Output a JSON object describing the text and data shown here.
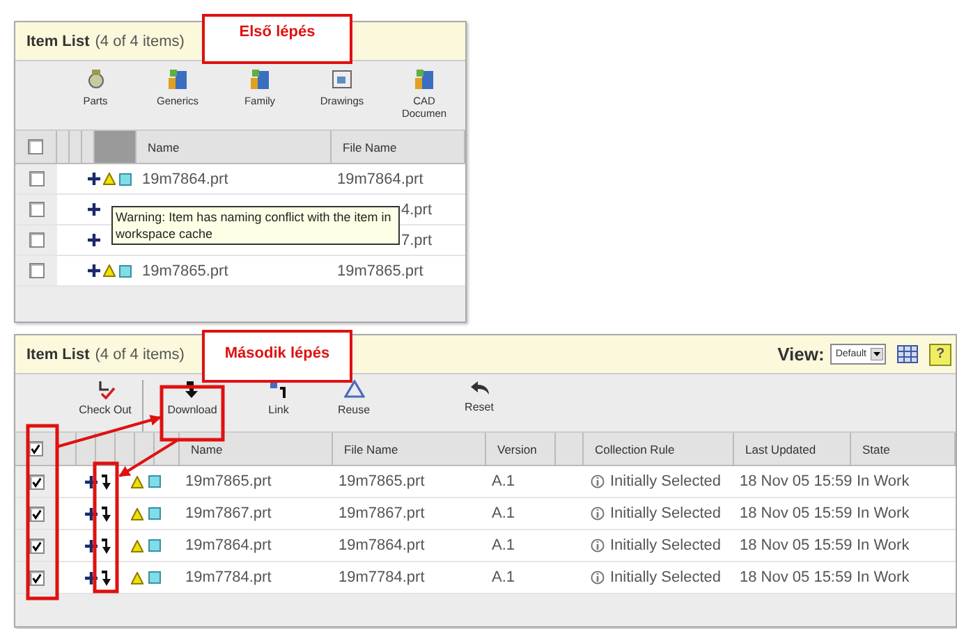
{
  "first_step": {
    "title": "Item List",
    "count": "(4 of 4 items)",
    "step_label": "Első lépés",
    "tools": [
      {
        "label": "Parts"
      },
      {
        "label": "Generics"
      },
      {
        "label": "Family"
      },
      {
        "label": "Drawings"
      },
      {
        "label": "CAD Documen"
      }
    ],
    "columns": [
      "Name",
      "File Name"
    ],
    "select_all_checked": false,
    "rows": [
      {
        "checked": false,
        "name": "19m7864.prt",
        "file_name": "19m7864.prt"
      },
      {
        "checked": false,
        "file_name": "4.prt"
      },
      {
        "checked": false,
        "file_name": "7.prt"
      },
      {
        "checked": false,
        "name": "19m7865.prt",
        "file_name": "19m7865.prt"
      }
    ],
    "tooltip": "Warning: Item has naming conflict with the item in workspace cache"
  },
  "second_step": {
    "title": "Item List",
    "count": "(4 of 4 items)",
    "step_label": "Második lépés",
    "view_label": "View:",
    "view_value": "Default",
    "help_label": "?",
    "tools": [
      {
        "label": "Check Out"
      },
      {
        "label": "Download"
      },
      {
        "label": "Link"
      },
      {
        "label": "Reuse"
      },
      {
        "label": "Reset"
      }
    ],
    "columns": [
      "Name",
      "File Name",
      "Version",
      "Collection Rule",
      "Last Updated",
      "State"
    ],
    "select_all_checked": true,
    "rows": [
      {
        "checked": true,
        "name": "19m7865.prt",
        "file_name": "19m7865.prt",
        "version": "A.1",
        "rule": "Initially Selected",
        "updated": "18 Nov 05 15:59",
        "state": "In Work"
      },
      {
        "checked": true,
        "name": "19m7867.prt",
        "file_name": "19m7867.prt",
        "version": "A.1",
        "rule": "Initially Selected",
        "updated": "18 Nov 05 15:59",
        "state": "In Work"
      },
      {
        "checked": true,
        "name": "19m7864.prt",
        "file_name": "19m7864.prt",
        "version": "A.1",
        "rule": "Initially Selected",
        "updated": "18 Nov 05 15:59",
        "state": "In Work"
      },
      {
        "checked": true,
        "name": "19m7784.prt",
        "file_name": "19m7784.prt",
        "version": "A.1",
        "rule": "Initially Selected",
        "updated": "18 Nov 05 15:59",
        "state": "In Work"
      }
    ]
  }
}
